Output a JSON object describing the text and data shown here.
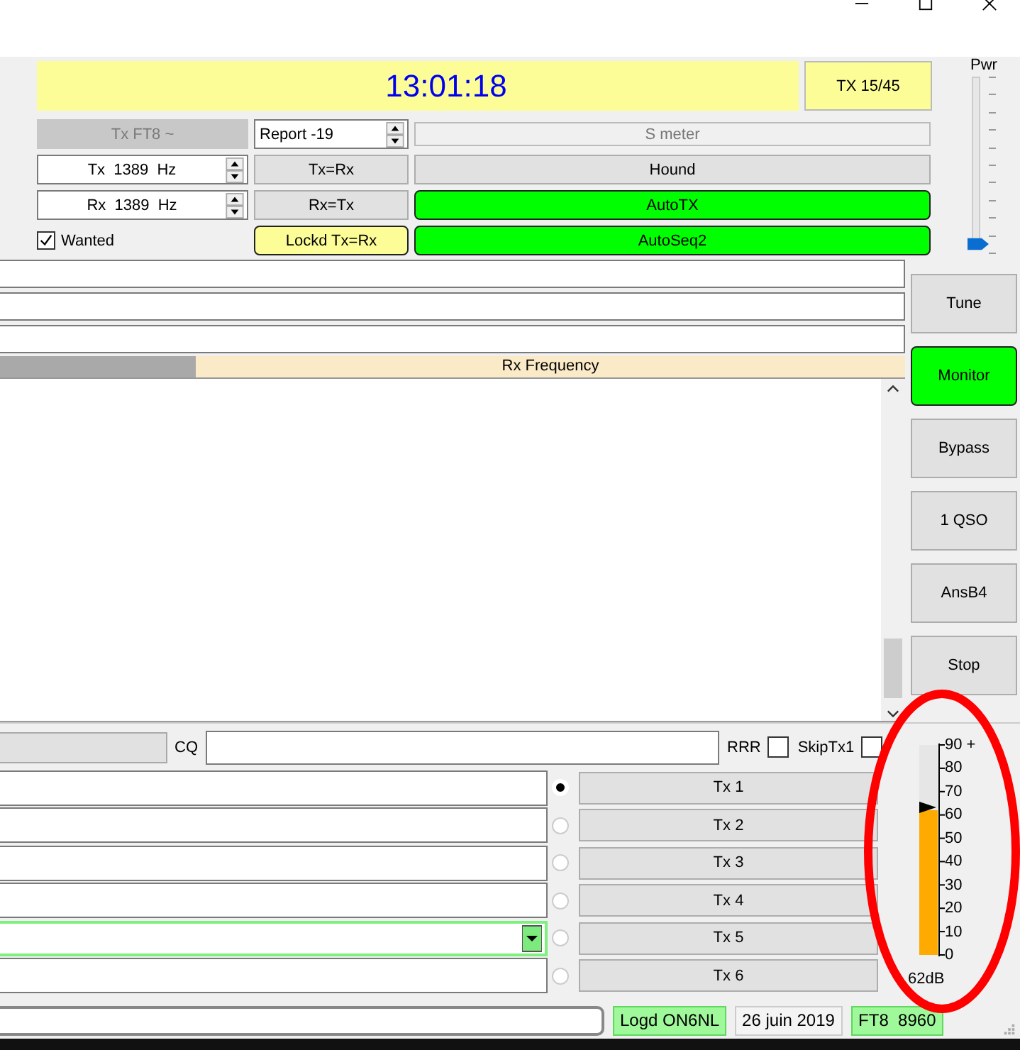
{
  "clock": "13:01:18",
  "tx_period_button": "TX 15/45",
  "mode_button": {
    "label": "Tx FT8 ~",
    "disabled": true
  },
  "report": {
    "value": "Report -19"
  },
  "s_meter": "S meter",
  "frequencies": [
    {
      "value": "Tx  1389  Hz"
    },
    {
      "value": "Rx  1389  Hz"
    }
  ],
  "wanted": {
    "label": "Wanted",
    "checked": true
  },
  "middle_buttons": [
    {
      "label": "Tx=Rx",
      "on": false
    },
    {
      "label": "Rx=Tx",
      "on": false
    },
    {
      "label": "Lockd Tx=Rx",
      "on": true
    }
  ],
  "wide_buttons": [
    {
      "label": "Hound",
      "on": false
    },
    {
      "label": "AutoTX",
      "on": true
    },
    {
      "label": "AutoSeq2",
      "on": true
    }
  ],
  "power": {
    "label": "Pwr",
    "level": 0.04
  },
  "rx_frequency_header": "Rx Frequency",
  "cq_label": "CQ",
  "checkboxes": [
    {
      "label": "RRR",
      "checked": false
    },
    {
      "label": "SkipTx1",
      "checked": false
    }
  ],
  "tx_messages": [
    {
      "button": "Tx 1",
      "selected": true,
      "kind": "text"
    },
    {
      "button": "Tx 2",
      "selected": false,
      "kind": "text"
    },
    {
      "button": "Tx 3",
      "selected": false,
      "kind": "text"
    },
    {
      "button": "Tx 4",
      "selected": false,
      "kind": "text"
    },
    {
      "button": "Tx 5",
      "selected": false,
      "kind": "combo"
    },
    {
      "button": "Tx 6",
      "selected": false,
      "kind": "text"
    }
  ],
  "side_buttons": [
    {
      "label": "Tune",
      "on": false
    },
    {
      "label": "Monitor",
      "on": true
    },
    {
      "label": "Bypass",
      "on": false
    },
    {
      "label": "1 QSO",
      "on": false
    },
    {
      "label": "AnsB4",
      "on": false
    },
    {
      "label": "Stop",
      "on": false
    }
  ],
  "signal_meter": {
    "level": 0.69,
    "reading": "62dB",
    "scale": [
      "90 +",
      "80",
      "70",
      "60",
      "50",
      "40",
      "30",
      "20",
      "10",
      "0"
    ]
  },
  "status_bar": [
    {
      "text": "Logd ON6NL",
      "highlighted": true
    },
    {
      "text": "26 juin 2019",
      "highlighted": false
    },
    {
      "text": "FT8  8960",
      "highlighted": true
    }
  ]
}
